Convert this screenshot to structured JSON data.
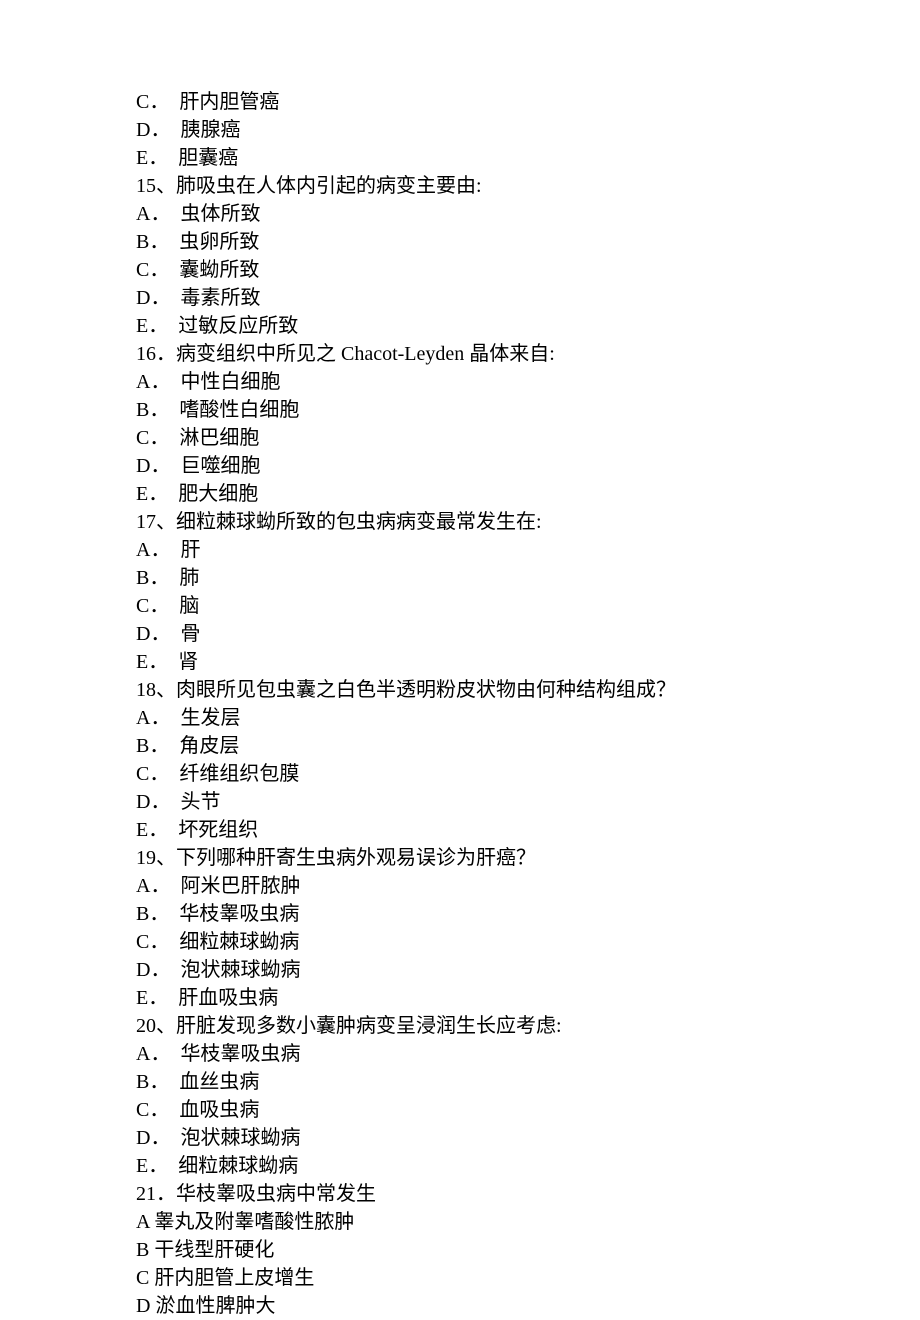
{
  "lines": [
    "C．  肝内胆管癌",
    "D．  胰腺癌",
    "E．  胆囊癌",
    "15、肺吸虫在人体内引起的病变主要由:",
    "A．  虫体所致",
    "B．  虫卵所致",
    "C．  囊蚴所致",
    "D．  毒素所致",
    "E．  过敏反应所致",
    "16．病变组织中所见之 Chacot-Leyden 晶体来自:",
    "A．  中性白细胞",
    "B．  嗜酸性白细胞",
    "C．  淋巴细胞",
    "D．  巨噬细胞",
    "E．  肥大细胞",
    "17、细粒棘球蚴所致的包虫病病变最常发生在:",
    "A．  肝",
    "B．  肺",
    "C．  脑",
    "D．  骨",
    "E．  肾",
    "18、肉眼所见包虫囊之白色半透明粉皮状物由何种结构组成？",
    "A．  生发层",
    "B．  角皮层",
    "C．  纤维组织包膜",
    "D．  头节",
    "E．  坏死组织",
    "19、下列哪种肝寄生虫病外观易误诊为肝癌？",
    "A．  阿米巴肝脓肿",
    "B．  华枝睾吸虫病",
    "C．  细粒棘球蚴病",
    "D．  泡状棘球蚴病",
    "E．  肝血吸虫病",
    "20、肝脏发现多数小囊肿病变呈浸润生长应考虑:",
    "A．  华枝睾吸虫病",
    "B．  血丝虫病",
    "C．  血吸虫病",
    "D．  泡状棘球蚴病",
    "E．  细粒棘球蚴病",
    "21．华枝睾吸虫病中常发生",
    "A 睾丸及附睾嗜酸性脓肿",
    "B 干线型肝硬化",
    "C 肝内胆管上皮增生",
    "D 淤血性脾肿大"
  ]
}
